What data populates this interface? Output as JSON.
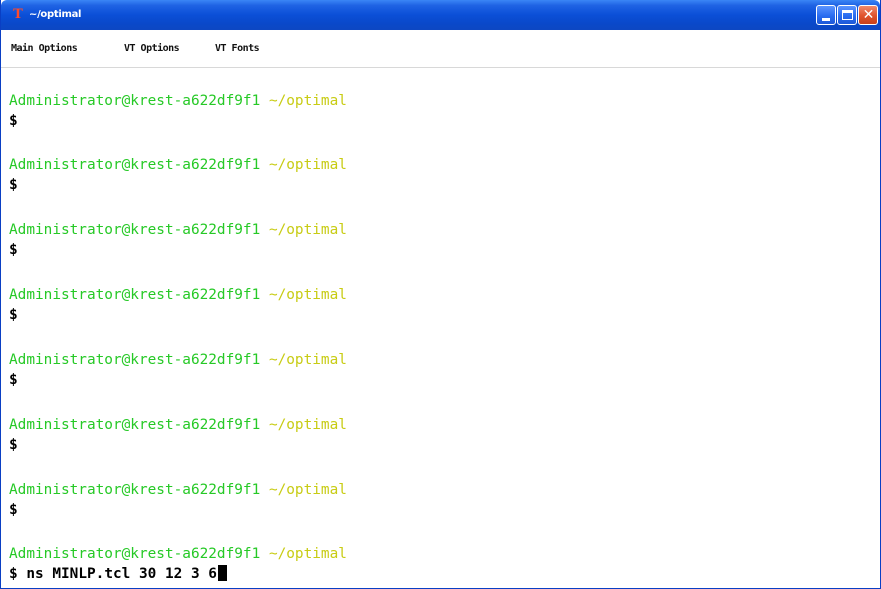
{
  "window": {
    "title": "~/optimal",
    "app_icon_glyph": "T",
    "controls": [
      "minimize",
      "maximize",
      "close"
    ],
    "close_glyph": "✕"
  },
  "menubar": {
    "items": [
      "Main Options",
      "VT Options",
      "VT Fonts"
    ]
  },
  "terminal": {
    "user_host": "Administrator@krest-a622df9f1",
    "cwd": "~/optimal",
    "prompt_symbol": "$",
    "blocks": [
      {
        "command": ""
      },
      {
        "command": ""
      },
      {
        "command": ""
      },
      {
        "command": ""
      },
      {
        "command": ""
      },
      {
        "command": ""
      },
      {
        "command": ""
      },
      {
        "command": "ns MINLP.tcl 30 12 3 6"
      }
    ]
  },
  "colors": {
    "titlebar": "#0b4fd7",
    "user_host": "#26c926",
    "path": "#c8cc14",
    "text": "#000000",
    "app_icon": "#ff4a2a"
  },
  "icons": [
    "app-icon",
    "minimize-icon",
    "maximize-icon",
    "close-icon",
    "text-cursor"
  ]
}
